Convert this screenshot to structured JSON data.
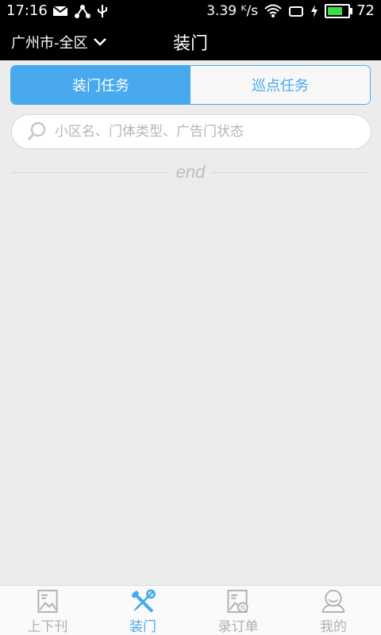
{
  "status_bar": {
    "time": "17:16",
    "speed": "3.39 ᴷ/s",
    "battery": "72"
  },
  "header": {
    "city": "广州市-全区",
    "title": "装门"
  },
  "tabs": [
    {
      "label": "装门任务",
      "active": true
    },
    {
      "label": "巡点任务",
      "active": false
    }
  ],
  "search": {
    "placeholder": "小区名、门体类型、广告门状态"
  },
  "list_end": "end",
  "bottom_nav": [
    {
      "label": "上下刊",
      "icon": "image-doc-icon",
      "active": false
    },
    {
      "label": "装门",
      "icon": "tools-icon",
      "active": true
    },
    {
      "label": "录订单",
      "icon": "order-doc-icon",
      "active": false
    },
    {
      "label": "我的",
      "icon": "profile-icon",
      "active": false
    }
  ],
  "colors": {
    "accent": "#48a9ee",
    "background": "#ececec"
  }
}
